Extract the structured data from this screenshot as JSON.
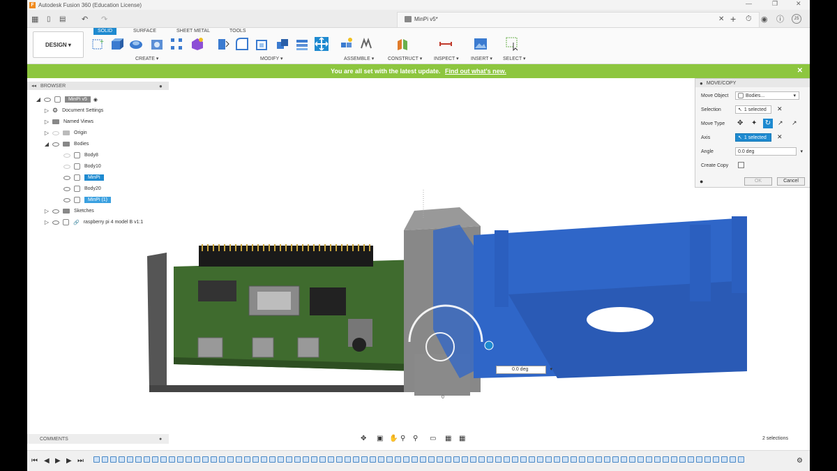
{
  "window": {
    "title": "Autodesk Fusion 360 (Education License)"
  },
  "document": {
    "tab_title": "MinPi v5*"
  },
  "workspace": {
    "label": "DESIGN"
  },
  "toolbar": {
    "tabs": [
      "SOLID",
      "SURFACE",
      "SHEET METAL",
      "TOOLS"
    ],
    "active_tab": "SOLID",
    "groups": [
      "CREATE",
      "MODIFY",
      "ASSEMBLE",
      "CONSTRUCT",
      "INSPECT",
      "INSERT",
      "SELECT"
    ]
  },
  "banner": {
    "text": "You are all set with the latest update.",
    "link": "Find out what's new."
  },
  "browser": {
    "header": "BROWSER",
    "root": "MinPi v5",
    "items": [
      "Document Settings",
      "Named Views",
      "Origin",
      "Bodies",
      "Body8",
      "Body10",
      "MinPi",
      "Body20",
      "MinPi (1)",
      "Sketches",
      "raspberry pi 4 model B v1:1"
    ]
  },
  "move_copy": {
    "title": "MOVE/COPY",
    "labels": {
      "move_object": "Move Object",
      "selection": "Selection",
      "move_type": "Move Type",
      "axis": "Axis",
      "angle": "Angle",
      "create_copy": "Create Copy"
    },
    "move_object_value": "Bodies...",
    "selection_value": "1 selected",
    "axis_value": "1 selected",
    "angle_value": "0.0 deg",
    "ok": "OK",
    "cancel": "Cancel"
  },
  "viewport": {
    "angle_input": "0.0 deg",
    "origin_label": "0"
  },
  "comments": {
    "label": "COMMENTS"
  },
  "status": {
    "selections": "2 selections"
  },
  "colors": {
    "accent": "#1e8ad0",
    "banner": "#8dc63f",
    "part_blue": "#2f66c8",
    "board_green": "#3f6b2e"
  }
}
